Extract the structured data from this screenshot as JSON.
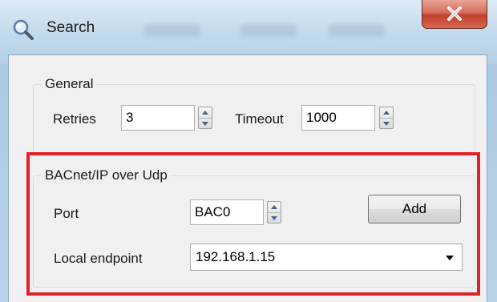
{
  "window": {
    "title": "Search",
    "close_symbol": "x",
    "icon": "search-icon"
  },
  "general": {
    "label": "General",
    "retries_label": "Retries",
    "retries_value": "3",
    "timeout_label": "Timeout",
    "timeout_value": "1000"
  },
  "bacnet": {
    "label": "BACnet/IP over Udp",
    "port_label": "Port",
    "port_value": "BAC0",
    "add_label": "Add",
    "endpoint_label": "Local endpoint",
    "endpoint_value": "192.168.1.15"
  },
  "colors": {
    "highlight": "#e0202a",
    "close_button": "#c4402c"
  }
}
